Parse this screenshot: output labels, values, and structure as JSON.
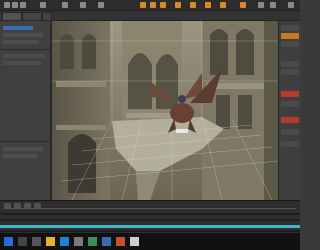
{
  "app": {
    "name": "3D scene editor",
    "accent": "#d78a2a",
    "viewport_bg": "#6e6a5c"
  },
  "toolbar": {
    "tools": [
      "select-icon",
      "move-icon",
      "rotate-icon",
      "scale-icon",
      "camera-icon",
      "light-icon",
      "render-icon",
      "pose-icon",
      "joint-icon",
      "morph-icon",
      "grid-icon",
      "settings-icon"
    ]
  },
  "timeline": {
    "buttons": [
      "play-icon",
      "stop-icon",
      "keyframe-icon",
      "loop-icon"
    ],
    "track_color": "#3fb7c9"
  },
  "taskbar": {
    "icons": [
      "start-icon",
      "search-icon",
      "task-view-icon",
      "explorer-icon",
      "browser-icon",
      "app-icon",
      "store-icon",
      "mail-icon",
      "media-icon",
      "studio-icon"
    ],
    "clock_time": "",
    "clock_date": ""
  }
}
